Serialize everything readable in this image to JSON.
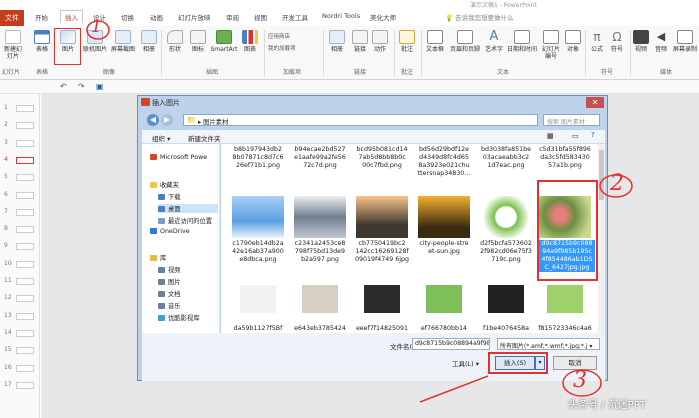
{
  "window": {
    "title": "演示文稿1 - PowerPoint",
    "user_hint": "告诉我您想要做什么"
  },
  "tabs": [
    "文件",
    "开始",
    "插入",
    "设计",
    "切换",
    "动画",
    "幻灯片放映",
    "审阅",
    "视图",
    "开发工具",
    "Nordri Tools",
    "美化大师"
  ],
  "ribbon": {
    "buttons": [
      "新建幻灯片",
      "表格",
      "图片",
      "联机图片",
      "屏幕截图",
      "相册",
      "形状",
      "图标",
      "SmartArt",
      "图表",
      "应用商店",
      "我的加载项",
      "相册",
      "链接",
      "动作",
      "批注",
      "文本框",
      "页眉和页脚",
      "艺术字",
      "日期和时间",
      "幻灯片编号",
      "对象",
      "公式",
      "符号",
      "视频",
      "音频",
      "屏幕录制"
    ],
    "groups": [
      "幻灯片",
      "表格",
      "图像",
      "插图",
      "加载项",
      "链接",
      "批注",
      "文本",
      "符号",
      "媒体"
    ]
  },
  "dialog": {
    "title": "插入图片",
    "path": [
      "图片素材"
    ],
    "search_placeholder": "搜索 图片素材",
    "organize": "组织 ▾",
    "new_folder": "新建文件夹",
    "nav": [
      {
        "label": "Microsoft Powe",
        "color": "#d24726"
      },
      {
        "label": "收藏夹",
        "color": "#f2c744"
      },
      {
        "label": "下载",
        "color": "#4a7fc1"
      },
      {
        "label": "桌面",
        "color": "#4a7fc1"
      },
      {
        "label": "最近访问的位置",
        "color": "#7a9cc6"
      },
      {
        "label": "OneDrive",
        "color": "#2b7cd3"
      },
      {
        "label": "库",
        "color": "#e8b84a"
      },
      {
        "label": "视频",
        "color": "#6a7fa6"
      },
      {
        "label": "图片",
        "color": "#6a7fa6"
      },
      {
        "label": "文档",
        "color": "#6a7fa6"
      },
      {
        "label": "音乐",
        "color": "#6a7fa6"
      },
      {
        "label": "优酷影视库",
        "color": "#3f9ad6"
      }
    ],
    "files_row1": [
      "b8b197943db2\n8b07871c8d7c6\n26ef71b1.png",
      "b94ecae2bd527\ne1aafe99a2fe56\n72c7d.png",
      "bcd95b081cd14\n7ab5d8bb8b0c\n00c7fbd.png",
      "bd56d29bdf12e\nd4349d8fc4d65\n8a3923e021chu\nttersnap34830...",
      "bd3038fa851be\n03acaeabb3c2\n1d7eac.png",
      "c5d31bfa55f896\nda3c5fd583430\n57a1b.png"
    ],
    "files_row2": [
      "c1790eb14db2a\n42e16ab37a900\ne8dbca.png",
      "c2341a2453ce8\n798f75bd13de9\nb2a597.png",
      "cb7750419bc2\n142cc16269128f\n09019f4749 6jpg",
      "city-people-stre\net-sun.jpg",
      "d2f5bcfa573602\n2f982cd06e75f3\n719c.png",
      "d9c8715b9c088\n94a9f985b195c\n4f854486ab1DS\nC_6427jpg.jpg"
    ],
    "files_row3": [
      "da59b1127f5Bf",
      "e643eb3785424",
      "eeef7f14825091",
      "ef766780bb14",
      "f1be4076458a",
      "f815723346c4a6"
    ],
    "filename_label": "文件名(N):",
    "filename_value": "d9c8715b9c08894a9f985b195c4f854486ab1DSC_6427jpg.jpg",
    "filetype": "所有图片(*.emf;*.wmf;*.jpg;*.j ▾",
    "tools": "工具(L) ▾",
    "insert": "插入(S)",
    "cancel": "取消"
  },
  "slides": [
    "1",
    "2",
    "3",
    "4",
    "5",
    "6",
    "7",
    "8",
    "9",
    "10",
    "11",
    "12",
    "13",
    "14",
    "15",
    "16",
    "17"
  ],
  "annotations": {
    "n1": "1",
    "n2": "2",
    "n3": "3"
  },
  "watermark": "头条号 / 沉迷PPT",
  "colors": {
    "accent": "#c43e1c",
    "annotation": "#e0322f",
    "dialog_frame": "#bcd3eb"
  }
}
